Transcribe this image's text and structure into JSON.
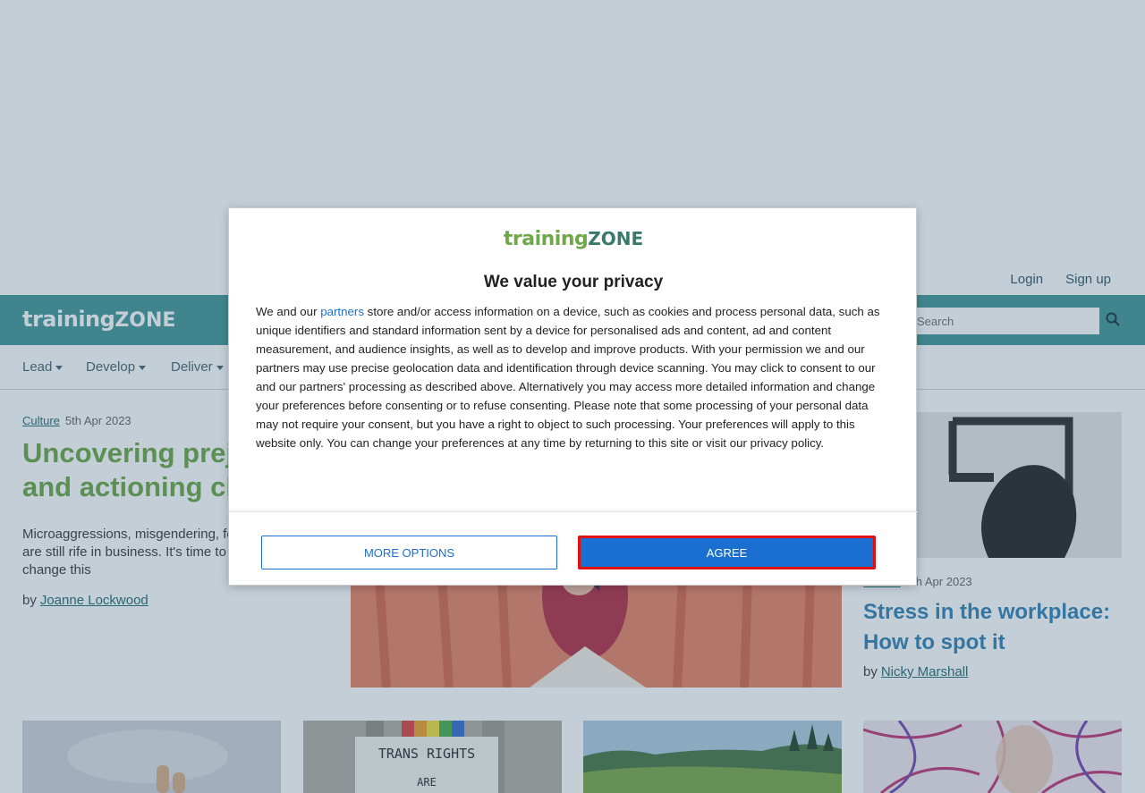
{
  "header": {
    "login_label": "Login",
    "signup_label": "Sign up",
    "brand_part1": "training",
    "brand_part2": "ZONE",
    "search_placeholder": "Search"
  },
  "nav": {
    "items": [
      {
        "label": "Lead"
      },
      {
        "label": "Develop"
      },
      {
        "label": "Deliver"
      }
    ]
  },
  "hero": {
    "category": "Culture",
    "date": "5th Apr 2023",
    "title": "Uncovering prejudice and actioning change",
    "description": "Microaggressions, misgendering, fear and ridicule are still rife in business. It's time to act now to change this",
    "byline_prefix": "by",
    "author": "Joanne Lockwood"
  },
  "side_article": {
    "category": "Culture",
    "date": "5th Apr 2023",
    "title": "Stress in the workplace: How to spot it",
    "byline_prefix": "by",
    "author": "Nicky Marshall"
  },
  "thumbs": {
    "sign_line1": "TRANS RIGHTS",
    "sign_line2": "ARE"
  },
  "consent": {
    "logo_part1": "training",
    "logo_part2": "ZONE",
    "heading": "We value your privacy",
    "body_pre_link": "We and our ",
    "partners_link": "partners",
    "body_post_link": " store and/or access information on a device, such as cookies and process personal data, such as unique identifiers and standard information sent by a device for personalised ads and content, ad and content measurement, and audience insights, as well as to develop and improve products. With your permission we and our partners may use precise geolocation data and identification through device scanning. You may click to consent to our and our partners' processing as described above. Alternatively you may access more detailed information and change your preferences before consenting or to refuse consenting. Please note that some processing of your personal data may not require your consent, but you have a right to object to such processing. Your preferences will apply to this website only. You can change your preferences at any time by returning to this site or visit our privacy policy.",
    "more_options_label": "MORE OPTIONS",
    "agree_label": "AGREE"
  },
  "colors": {
    "brand_teal": "#4a9a9a",
    "headline_green": "#6fa84a",
    "link_blue": "#3a86b5",
    "consent_blue": "#1a6fd0",
    "highlight_red": "#e01010"
  }
}
